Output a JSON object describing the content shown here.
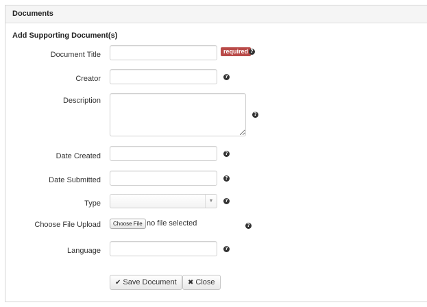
{
  "panel": {
    "heading": "Documents"
  },
  "form": {
    "section_title": "Add Supporting Document(s)",
    "fields": {
      "document_title": {
        "label": "Document Title",
        "value": "",
        "badge": "required"
      },
      "creator": {
        "label": "Creator",
        "value": ""
      },
      "description": {
        "label": "Description",
        "value": ""
      },
      "date_created": {
        "label": "Date Created",
        "value": ""
      },
      "date_submitted": {
        "label": "Date Submitted",
        "value": ""
      },
      "type": {
        "label": "Type",
        "selected": ""
      },
      "file_upload": {
        "label": "Choose File Upload",
        "button": "Choose File",
        "status": "no file selected"
      },
      "language": {
        "label": "Language",
        "value": ""
      }
    },
    "help_glyph": "?",
    "actions": {
      "save": {
        "icon": "check-icon",
        "glyph": "✔",
        "label": "Save Document"
      },
      "close": {
        "icon": "close-icon",
        "glyph": "✖",
        "label": "Close"
      }
    }
  },
  "colors": {
    "required_badge": "#b94a48",
    "heading_bg": "#f5f5f5"
  }
}
